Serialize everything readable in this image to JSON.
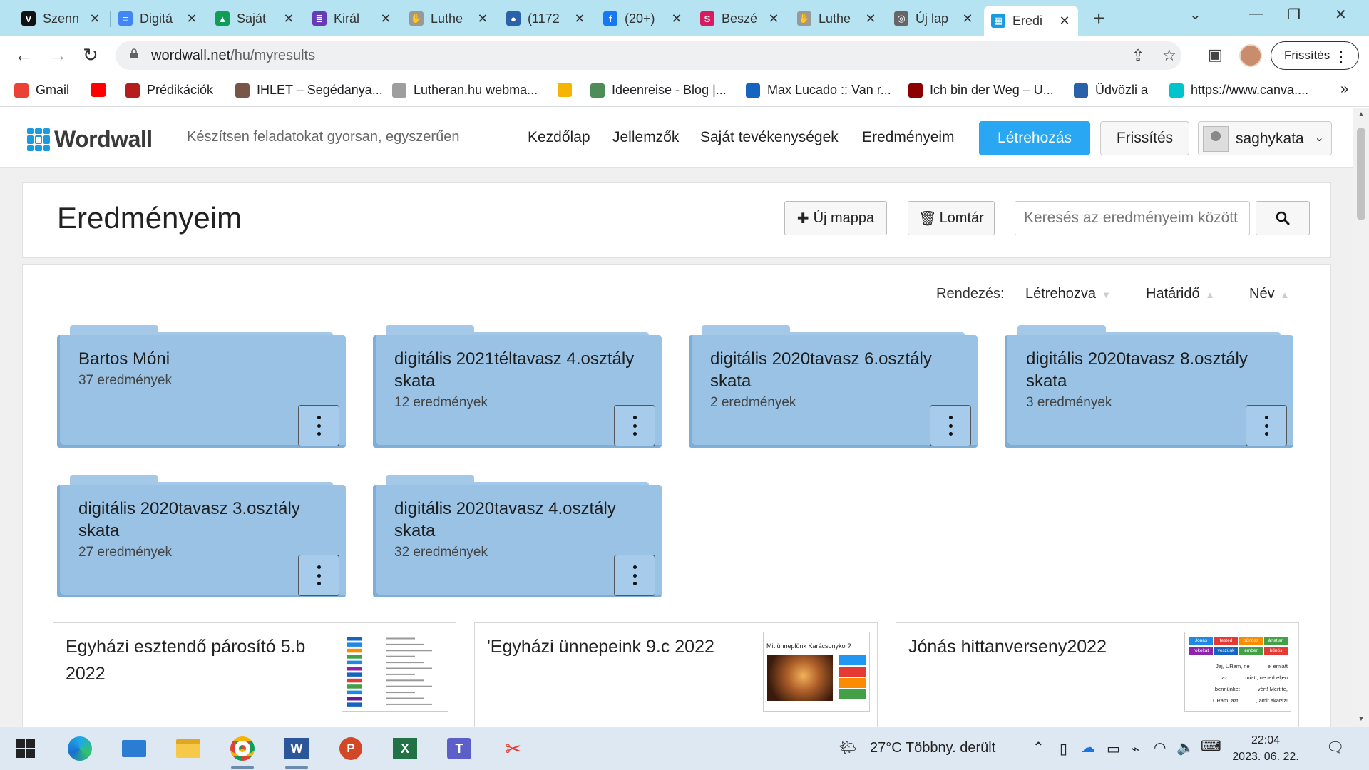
{
  "browser": {
    "tabs": [
      {
        "title": "Szenn",
        "color": "#111111",
        "glyph": "V"
      },
      {
        "title": "Digitá",
        "color": "#4285f4",
        "glyph": "≡"
      },
      {
        "title": "Saját",
        "color": "#0f9d58",
        "glyph": "▲"
      },
      {
        "title": "Királ",
        "color": "#673ab7",
        "glyph": "≣"
      },
      {
        "title": "Luthe",
        "color": "#999999",
        "glyph": "✋"
      },
      {
        "title": "(1172",
        "color": "#2962a8",
        "glyph": "●"
      },
      {
        "title": "(20+)",
        "color": "#1877f2",
        "glyph": "f"
      },
      {
        "title": "Beszé",
        "color": "#d81b60",
        "glyph": "S"
      },
      {
        "title": "Luthe",
        "color": "#999999",
        "glyph": "✋"
      },
      {
        "title": "Új lap",
        "color": "#666666",
        "glyph": "◎"
      },
      {
        "title": "Eredi",
        "color": "#1a9be0",
        "glyph": "▦"
      }
    ],
    "tab_close": "✕",
    "new_tab": "+",
    "url_domain": "wordwall.net",
    "url_path": "/hu/myresults",
    "refresh_chip": "Frissítés",
    "bookmarks": [
      {
        "label": "Gmail",
        "color": "#ea4335"
      },
      {
        "label": "",
        "color": "#ff0000"
      },
      {
        "label": "Prédikációk",
        "color": "#b71c1c"
      },
      {
        "label": "IHLET – Segédanya...",
        "color": "#795548"
      },
      {
        "label": "Lutheran.hu webma...",
        "color": "#9e9e9e"
      },
      {
        "label": "",
        "color": "#f4b400"
      },
      {
        "label": "Ideenreise - Blog |...",
        "color": "#4e8c5a"
      },
      {
        "label": "Max Lucado :: Van r...",
        "color": "#1565c0"
      },
      {
        "label": "Ich bin der Weg – U...",
        "color": "#8b0000"
      },
      {
        "label": "Üdvözli a",
        "color": "#2962a8"
      },
      {
        "label": "https://www.canva....",
        "color": "#00c4cc"
      }
    ],
    "bookmarks_more": "»"
  },
  "app": {
    "logo": "Wordwall",
    "tagline": "Készítsen feladatokat gyorsan, egyszerűen",
    "nav": [
      "Kezdőlap",
      "Jellemzők",
      "Saját tevékenységek",
      "Eredményeim"
    ],
    "create_button": "Létrehozás",
    "upgrade_button": "Frissítés",
    "username": "saghykata"
  },
  "results": {
    "title": "Eredményeim",
    "new_folder": "Új mappa",
    "trash": "Lomtár",
    "search_placeholder": "Keresés az eredményeim között",
    "sort_label": "Rendezés:",
    "sort_options": [
      "Létrehozva",
      "Határidő",
      "Név"
    ],
    "folders": [
      {
        "name": "Bartos Móni",
        "count": "37 eredmények"
      },
      {
        "name": "digitális 2021téltavasz 4.osztály skata",
        "count": "12 eredmények"
      },
      {
        "name": "digitális 2020tavasz 6.osztály skata",
        "count": "2 eredmények"
      },
      {
        "name": "digitális 2020tavasz 8.osztály skata",
        "count": "3 eredmények"
      },
      {
        "name": "digitális 2020tavasz 3.osztály skata",
        "count": "27 eredmények"
      },
      {
        "name": "digitális 2020tavasz 4.osztály skata",
        "count": "32 eredmények"
      }
    ],
    "activities": [
      {
        "name": "Egyházi esztendő párosító 5.b 2022"
      },
      {
        "name": "'Egyházi ünnepeink 9.c 2022",
        "thumb_title": "Mit ünneplünk Karácsonykor?"
      },
      {
        "name": "Jónás hittanverseny2022",
        "thumb_words": [
          "Jónás",
          "tested",
          "bűnöss",
          "ártatlan",
          "rokoltat",
          "veszünk",
          "ember",
          "bűnös"
        ],
        "thumb_lines": [
          "Jaj, URam, ne            el emiatt",
          "az            miatt, ne terheljen",
          "bennünket            vért! Mert te,",
          "URam, azt            , amit akarsz!"
        ]
      }
    ]
  },
  "taskbar": {
    "weather": "27°C  Többny. derült",
    "time": "22:04",
    "date": "2023. 06. 22."
  }
}
